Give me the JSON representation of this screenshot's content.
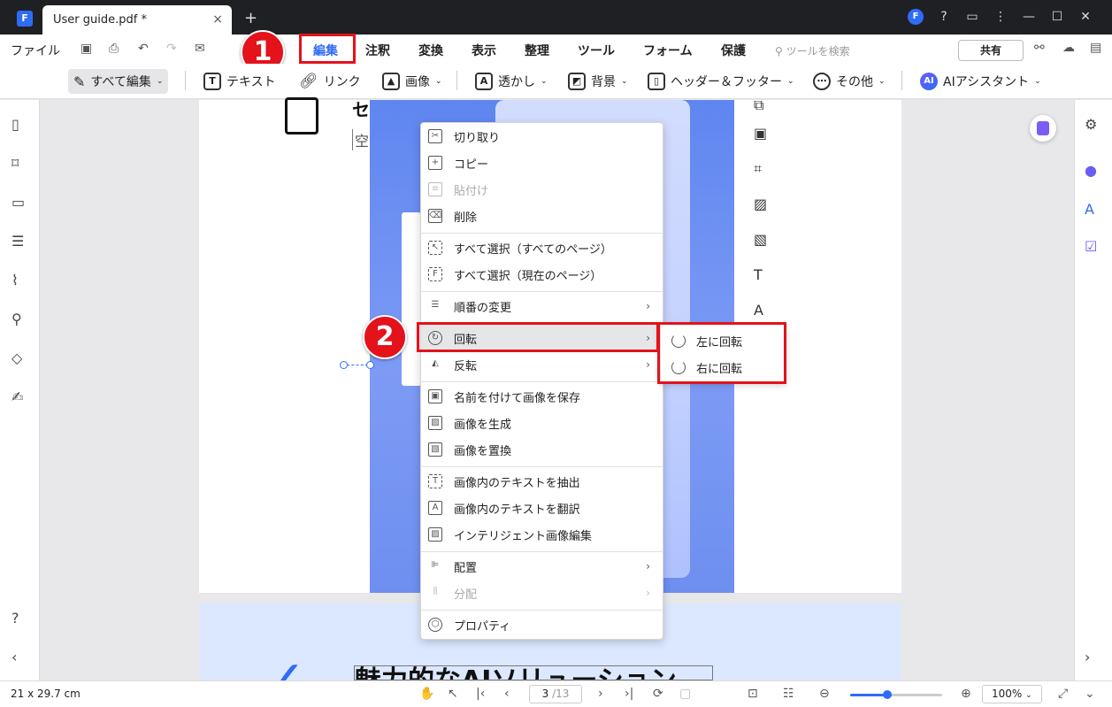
{
  "window": {
    "tab_title": "User guide.pdf *",
    "tab_close": "×",
    "new_tab": "+"
  },
  "menubar": {
    "file": "ファイル",
    "tabs": [
      "編集",
      "注釈",
      "変換",
      "表示",
      "整理",
      "ツール",
      "フォーム",
      "保護"
    ],
    "active_tab": "編集",
    "search_placeholder": "ツールを検索",
    "share": "共有"
  },
  "toolbar": {
    "edit_all": "すべて編集",
    "text": "テキスト",
    "link": "リンク",
    "image": "画像",
    "watermark": "透かし",
    "background": "背景",
    "header_footer": "ヘッダー＆フッター",
    "more": "その他",
    "ai_assistant": "AIアシスタント"
  },
  "document": {
    "top_char": "セ",
    "top_char2": "空",
    "bottom_heading": "魅力的なAIソリューション"
  },
  "context_menu": {
    "items": [
      {
        "label": "切り取り",
        "disabled": false
      },
      {
        "label": "コピー",
        "disabled": false
      },
      {
        "label": "貼付け",
        "disabled": true
      },
      {
        "label": "削除",
        "disabled": false
      },
      {
        "label": "すべて選択（すべてのページ）",
        "disabled": false
      },
      {
        "label": "すべて選択（現在のページ）",
        "disabled": false
      },
      {
        "label": "順番の変更",
        "disabled": false,
        "submenu": true
      },
      {
        "label": "回転",
        "disabled": false,
        "submenu": true,
        "hover": true
      },
      {
        "label": "反転",
        "disabled": false,
        "submenu": true
      },
      {
        "label": "名前を付けて画像を保存",
        "disabled": false
      },
      {
        "label": "画像を生成",
        "disabled": false
      },
      {
        "label": "画像を置換",
        "disabled": false
      },
      {
        "label": "画像内のテキストを抽出",
        "disabled": false
      },
      {
        "label": "画像内のテキストを翻訳",
        "disabled": false
      },
      {
        "label": "インテリジェント画像編集",
        "disabled": false
      },
      {
        "label": "配置",
        "disabled": false,
        "submenu": true
      },
      {
        "label": "分配",
        "disabled": true,
        "submenu": true
      },
      {
        "label": "プロパティ",
        "disabled": false
      }
    ],
    "rotate_submenu": [
      "左に回転",
      "右に回転"
    ]
  },
  "annotations": {
    "step1": "1",
    "step2": "2"
  },
  "statusbar": {
    "page_size": "21 x 29.7 cm",
    "current_page": "3",
    "total_pages": "/13",
    "zoom": "100%",
    "zoom_level": 0.4
  },
  "colors": {
    "accent": "#2e6cf6",
    "highlight": "#e3121b"
  }
}
